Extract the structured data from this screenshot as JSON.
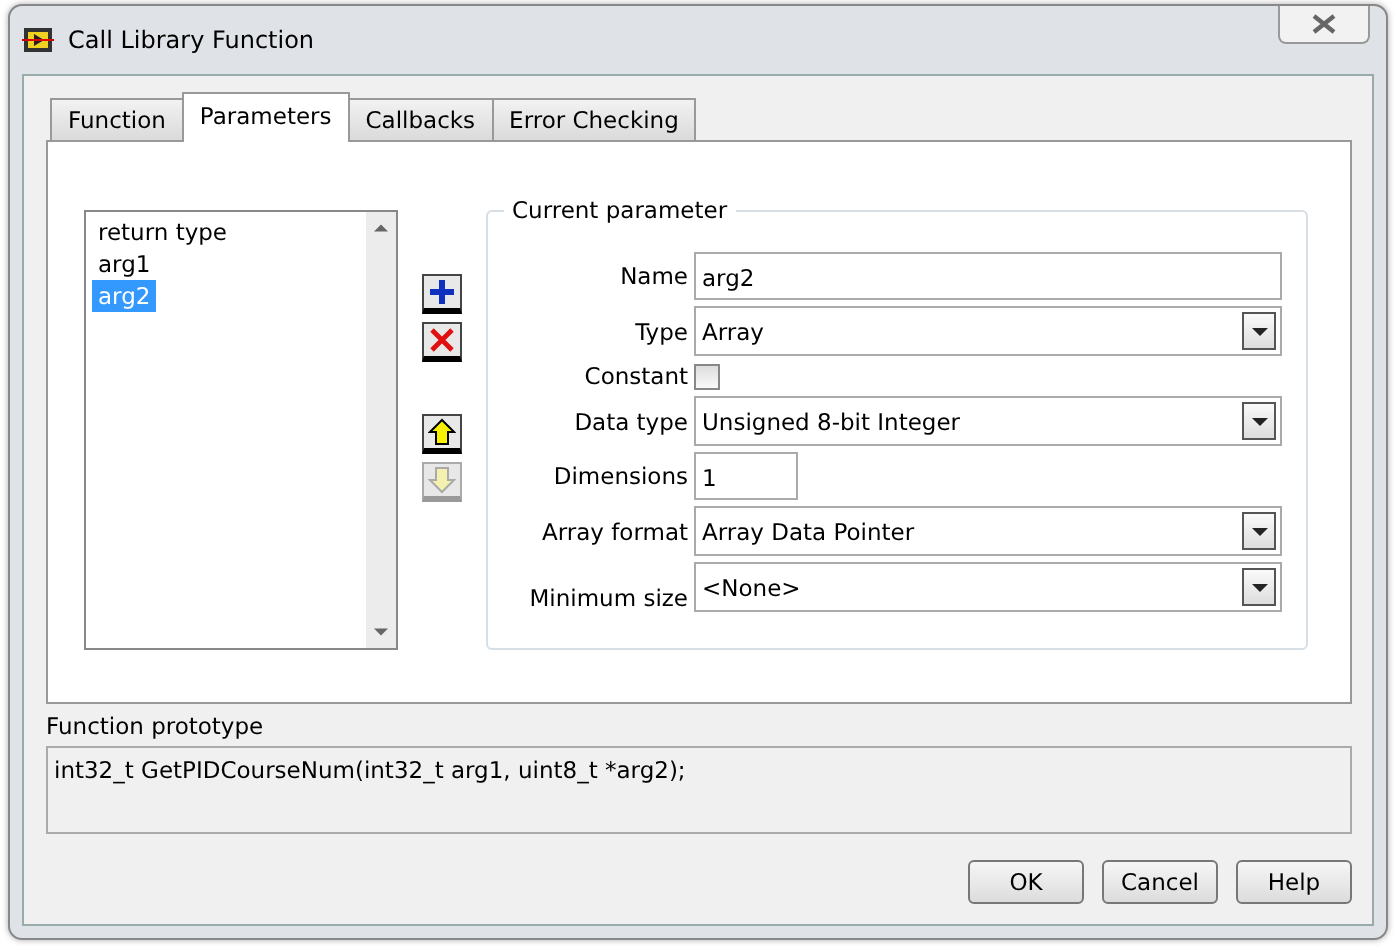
{
  "window": {
    "title": "Call Library Function"
  },
  "tabs": [
    {
      "label": "Function",
      "selected": false
    },
    {
      "label": "Parameters",
      "selected": true
    },
    {
      "label": "Callbacks",
      "selected": false
    },
    {
      "label": "Error Checking",
      "selected": false
    }
  ],
  "parameter_list": {
    "items": [
      {
        "label": "return type",
        "selected": false
      },
      {
        "label": "arg1",
        "selected": false
      },
      {
        "label": "arg2",
        "selected": true
      }
    ]
  },
  "list_buttons": [
    {
      "kind": "add",
      "disabled": false
    },
    {
      "kind": "delete",
      "disabled": false
    },
    {
      "kind": "gap"
    },
    {
      "kind": "up",
      "disabled": false
    },
    {
      "kind": "down",
      "disabled": true
    }
  ],
  "current_parameter": {
    "title": "Current parameter",
    "fields": [
      {
        "kind": "text",
        "label": "Name",
        "value": "arg2"
      },
      {
        "kind": "dropdown",
        "label": "Type",
        "value": "Array"
      },
      {
        "kind": "checkbox",
        "label": "Constant",
        "checked": false
      },
      {
        "kind": "dropdown",
        "label": "Data type",
        "value": "Unsigned 8-bit Integer"
      },
      {
        "kind": "number",
        "label": "Dimensions",
        "value": "1"
      },
      {
        "kind": "dropdown",
        "label": "Array format",
        "value": "Array Data Pointer"
      },
      {
        "kind": "dropdown",
        "label": "Minimum size",
        "value": "<None>"
      }
    ]
  },
  "prototype": {
    "label": "Function prototype",
    "text": "int32_t GetPIDCourseNum(int32_t arg1, uint8_t *arg2);"
  },
  "buttons": [
    "OK",
    "Cancel",
    "Help"
  ]
}
